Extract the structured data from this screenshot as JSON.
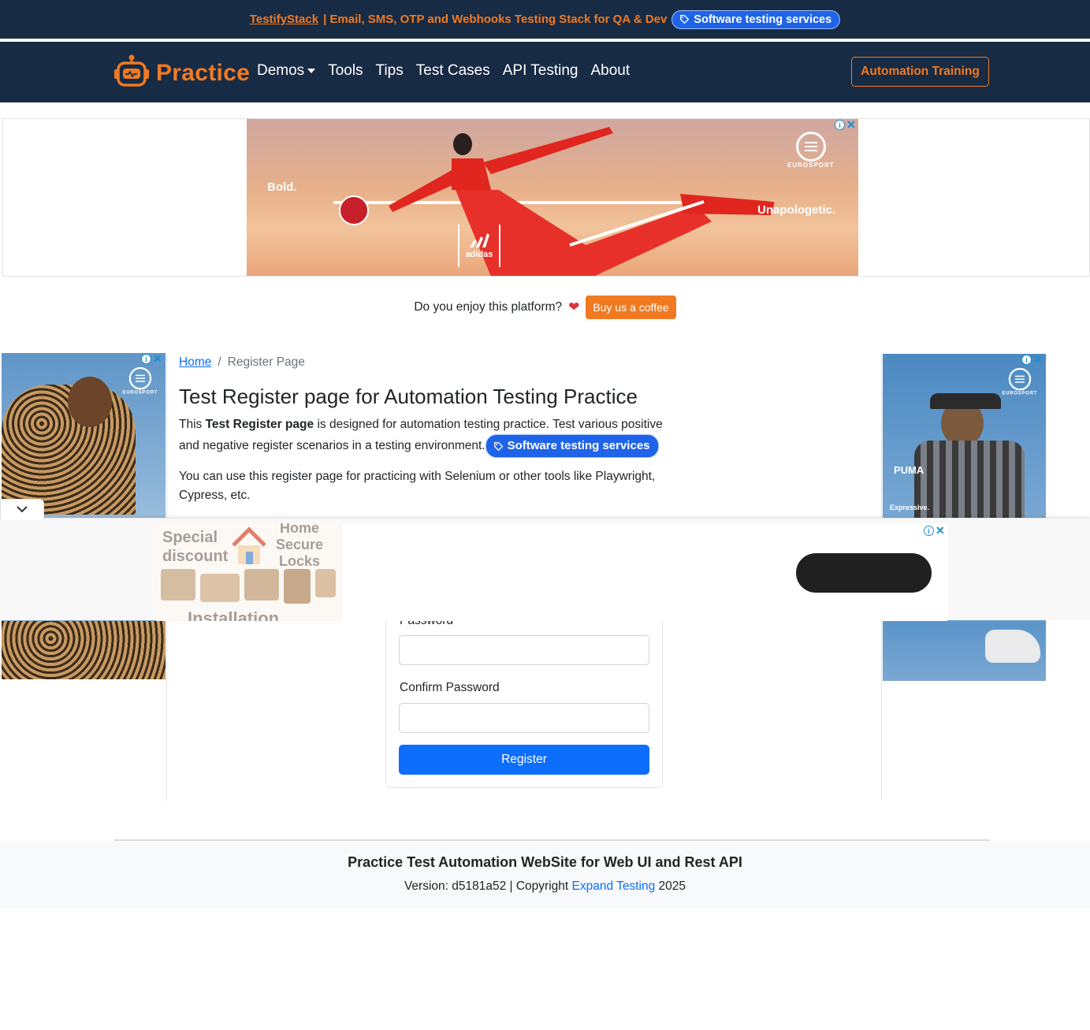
{
  "topbar": {
    "brand": "TestifyStack",
    "tagline": "| Email, SMS, OTP and Webhooks Testing Stack for QA & Dev",
    "pill_label": "Software testing services"
  },
  "navbar": {
    "brand": "Practice",
    "links": [
      "Demos",
      "Tools",
      "Tips",
      "Test Cases",
      "API Testing",
      "About"
    ],
    "cta": "Automation Training"
  },
  "ads": {
    "top_left_word": "Bold.",
    "top_right_word": "Unapologetic.",
    "eurosport": "EUROSPORT",
    "adidas": "adidas",
    "puma": "PUMA",
    "puma_tag": "Expressive.",
    "locks_special": "Special discount",
    "locks_home": "Home Secure Locks",
    "locks_install": "Installation"
  },
  "coffee": {
    "question": "Do you enjoy this platform?",
    "button": "Buy us a coffee"
  },
  "breadcrumb": {
    "home": "Home",
    "separator": "/",
    "current": "Register Page"
  },
  "main": {
    "title": "Test Register page for Automation Testing Practice",
    "intro_prefix": "This ",
    "intro_bold": "Test Register page",
    "intro_suffix": " is designed for automation testing practice. Test various positive and negative register scenarios in a testing environment.",
    "intro_pill": "Software testing services",
    "intro2": "You can use this register page for practicing with Selenium or other tools like Playwright, Cypress, etc."
  },
  "form": {
    "password_label": "Password",
    "confirm_label": "Confirm Password",
    "password_value": "",
    "confirm_value": "",
    "submit": "Register"
  },
  "footer": {
    "title": "Practice Test Automation WebSite for Web UI and Rest API",
    "version_prefix": "Version: d5181a52 | Copyright ",
    "link": "Expand Testing",
    "year": " 2025"
  },
  "colors": {
    "navy": "#172b45",
    "orange": "#f07a22",
    "primary": "#0d6efd"
  }
}
